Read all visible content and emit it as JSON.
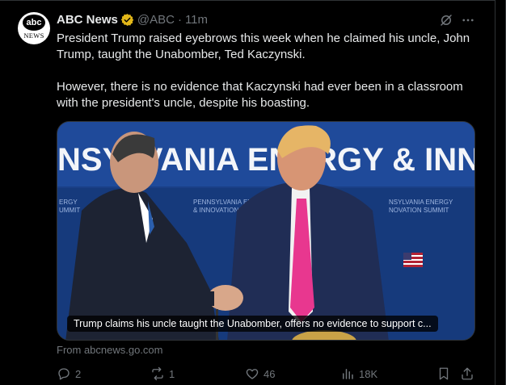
{
  "tweet": {
    "author_name": "ABC News",
    "handle": "@ABC",
    "separator": "·",
    "time": "11m",
    "avatar_top": "abc",
    "avatar_bottom": "NEWS",
    "paragraphs": [
      "President Trump raised eyebrows this week when he claimed his uncle, John Trump, taught the Unabomber, Ted Kaczynski.",
      "However, there is no evidence that Kaczynski had ever been in a classroom with the president's uncle, despite his boasting."
    ],
    "media": {
      "banner_text": "NSYLVANIA ENERGY & INNOVATIO",
      "caption": "Trump claims his uncle taught the Unabomber, offers no evidence to support c..."
    },
    "source": "From abcnews.go.com",
    "actions": {
      "replies": "2",
      "reposts": "1",
      "likes": "46",
      "views": "18K"
    }
  },
  "colors": {
    "background": "#000000",
    "text": "#e7e9ea",
    "muted": "#71767b",
    "verified_gold": "#e2b719",
    "banner_blue": "#1a3f86"
  }
}
